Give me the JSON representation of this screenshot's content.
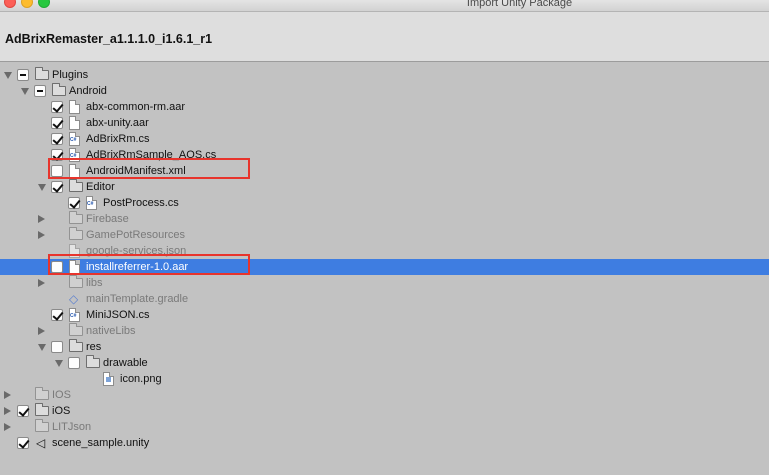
{
  "window": {
    "title": "Import Unity Package"
  },
  "package": {
    "name": "AdBrixRemaster_a1.1.1.0_i1.6.1_r1"
  },
  "tree": [
    {
      "label": "Plugins",
      "type": "folder",
      "check": "mixed",
      "expand": "open",
      "dim": false
    },
    {
      "label": "Android",
      "type": "folder",
      "check": "mixed",
      "expand": "open",
      "dim": false
    },
    {
      "label": "abx-common-rm.aar",
      "type": "file",
      "check": "checked",
      "expand": "none",
      "dim": false
    },
    {
      "label": "abx-unity.aar",
      "type": "file",
      "check": "checked",
      "expand": "none",
      "dim": false
    },
    {
      "label": "AdBrixRm.cs",
      "type": "cs",
      "check": "checked",
      "expand": "none",
      "dim": false
    },
    {
      "label": "AdBrixRmSample_AOS.cs",
      "type": "cs",
      "check": "checked",
      "expand": "none",
      "dim": false
    },
    {
      "label": "AndroidManifest.xml",
      "type": "file",
      "check": "unchecked",
      "expand": "none",
      "dim": false
    },
    {
      "label": "Editor",
      "type": "folder",
      "check": "checked",
      "expand": "open",
      "dim": false
    },
    {
      "label": "PostProcess.cs",
      "type": "cs",
      "check": "checked",
      "expand": "none",
      "dim": false
    },
    {
      "label": "Firebase",
      "type": "folder",
      "check": "none",
      "expand": "closed",
      "dim": true
    },
    {
      "label": "GamePotResources",
      "type": "folder",
      "check": "none",
      "expand": "closed",
      "dim": true
    },
    {
      "label": "google-services.json",
      "type": "file",
      "check": "none",
      "expand": "none",
      "dim": true
    },
    {
      "label": "installreferrer-1.0.aar",
      "type": "file",
      "check": "unchecked",
      "expand": "none",
      "dim": false,
      "selected": true
    },
    {
      "label": "libs",
      "type": "folder",
      "check": "none",
      "expand": "closed",
      "dim": true
    },
    {
      "label": "mainTemplate.gradle",
      "type": "vs",
      "check": "none",
      "expand": "none",
      "dim": true
    },
    {
      "label": "MiniJSON.cs",
      "type": "cs",
      "check": "checked",
      "expand": "none",
      "dim": false
    },
    {
      "label": "nativeLibs",
      "type": "folder",
      "check": "none",
      "expand": "closed",
      "dim": true
    },
    {
      "label": "res",
      "type": "folder",
      "check": "unchecked",
      "expand": "open",
      "dim": false
    },
    {
      "label": "drawable",
      "type": "folder",
      "check": "unchecked",
      "expand": "open",
      "dim": false
    },
    {
      "label": "icon.png",
      "type": "img",
      "check": "none",
      "expand": "none",
      "dim": false
    },
    {
      "label": "IOS",
      "type": "folder",
      "check": "none",
      "expand": "closed",
      "dim": true
    },
    {
      "label": "iOS",
      "type": "folder",
      "check": "checked",
      "expand": "closed",
      "dim": false
    },
    {
      "label": "LITJson",
      "type": "folder",
      "check": "none",
      "expand": "closed",
      "dim": true
    },
    {
      "label": "scene_sample.unity",
      "type": "unity",
      "check": "checked",
      "expand": "none",
      "dim": false
    }
  ],
  "colors": {
    "selection": "#3e7de1",
    "annotation": "#e8342c",
    "background": "#c2c2c2"
  }
}
